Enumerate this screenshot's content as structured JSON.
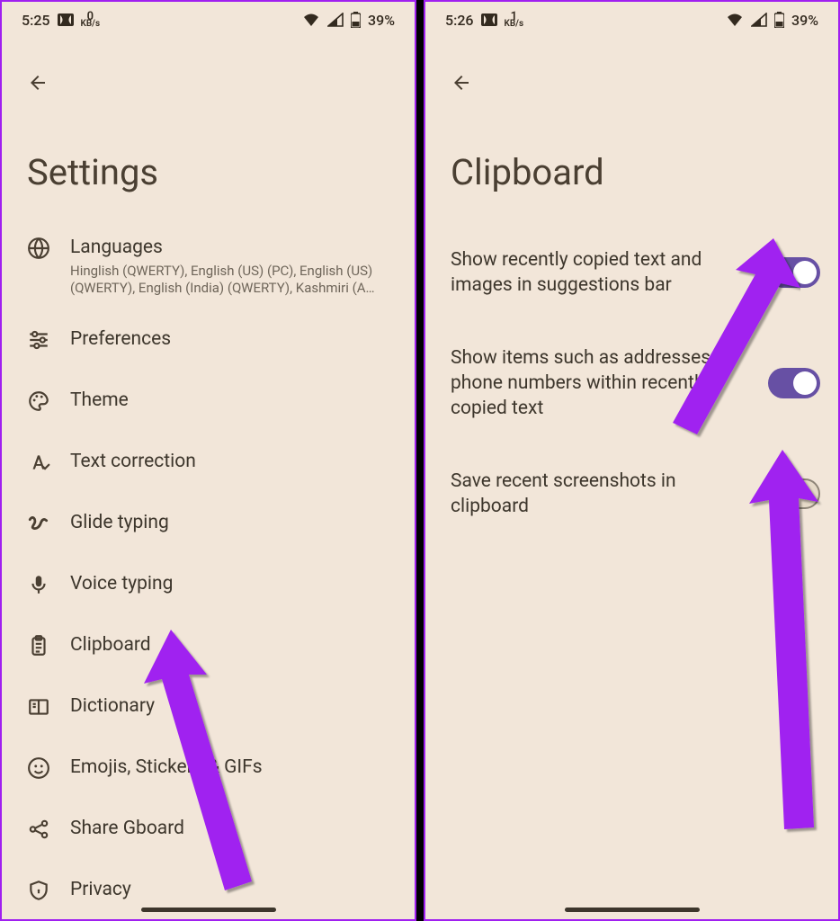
{
  "left": {
    "status": {
      "time": "5:25",
      "net_num": "0",
      "net_unit": "KB/s",
      "battery": "39%"
    },
    "title": "Settings",
    "items": [
      {
        "id": "languages",
        "label": "Languages",
        "sub": "Hinglish (QWERTY), English (US) (PC), English (US) (QWERTY), English (India) (QWERTY), Kashmiri (A…"
      },
      {
        "id": "preferences",
        "label": "Preferences"
      },
      {
        "id": "theme",
        "label": "Theme"
      },
      {
        "id": "text-correction",
        "label": "Text correction"
      },
      {
        "id": "glide-typing",
        "label": "Glide typing"
      },
      {
        "id": "voice-typing",
        "label": "Voice typing"
      },
      {
        "id": "clipboard",
        "label": "Clipboard"
      },
      {
        "id": "dictionary",
        "label": "Dictionary"
      },
      {
        "id": "emojis",
        "label": "Emojis, Stickers & GIFs"
      },
      {
        "id": "share",
        "label": "Share Gboard"
      },
      {
        "id": "privacy",
        "label": "Privacy"
      }
    ]
  },
  "right": {
    "status": {
      "time": "5:26",
      "net_num": "1",
      "net_unit": "KB/s",
      "battery": "39%"
    },
    "title": "Clipboard",
    "items": [
      {
        "id": "show-recent",
        "label": "Show recently copied text and images in suggestions bar",
        "on": true
      },
      {
        "id": "show-items",
        "label": "Show items such as addresses, phone numbers within recently copied text",
        "on": true
      },
      {
        "id": "save-screenshots",
        "label": "Save recent screenshots in clipboard",
        "on": false
      }
    ]
  },
  "colors": {
    "accent": "#6750a4",
    "annotation": "#a020f0"
  }
}
